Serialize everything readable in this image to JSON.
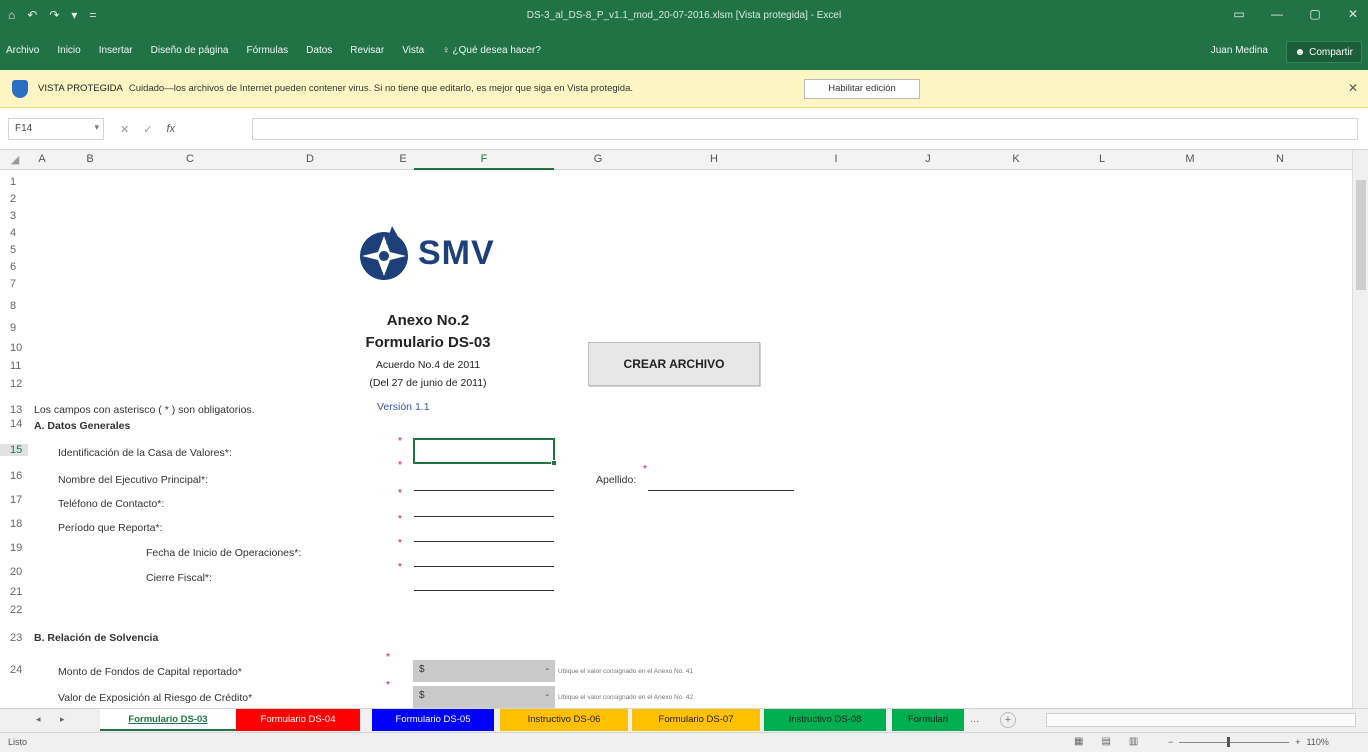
{
  "window": {
    "title": "DS-3_al_DS-8_P_v1.1_mod_20-07-2016.xlsm  [Vista protegida] - Excel",
    "qat": [
      "⌂",
      "↶",
      "↷",
      "▾",
      "="
    ],
    "controls": [
      "▭",
      "—",
      "▢",
      "✕"
    ]
  },
  "ribbon": {
    "tabs": [
      "Archivo",
      "Inicio",
      "Insertar",
      "Diseño de página",
      "Fórmulas",
      "Datos",
      "Revisar",
      "Vista",
      "♀ ¿Qué desea hacer?"
    ],
    "user": "Juan Medina",
    "share": "Compartir"
  },
  "protected_view": {
    "label": "VISTA PROTEGIDA",
    "message": "Cuidado—los archivos de Internet pueden contener virus. Si no tiene que editarlo, es mejor que siga en Vista protegida.",
    "enable_button": "Habilitar edición",
    "close": "✕"
  },
  "formula_bar": {
    "name_box": "F14",
    "cancel": "✕",
    "enter": "✓",
    "fx": "fx",
    "value": ""
  },
  "columns": [
    "A",
    "B",
    "C",
    "D",
    "E",
    "F",
    "G",
    "H",
    "I",
    "J",
    "K",
    "L",
    "M",
    "N"
  ],
  "rows": [
    "1",
    "2",
    "3",
    "4",
    "5",
    "6",
    "7",
    "8",
    "9",
    "10",
    "11",
    "12",
    "13",
    "14",
    "15",
    "16",
    "17",
    "18",
    "19",
    "20",
    "21",
    "22",
    "23",
    "24"
  ],
  "sheet": {
    "logo_text": "SMV",
    "anexo": "Anexo No.2",
    "formulario": "Formulario DS-03",
    "acuerdo": "Acuerdo No.4 de 2011",
    "fecha": "(Del 27 de junio de 2011)",
    "version": "Versión 1.1",
    "required_note": "Los campos con asterisco ( * ) son obligatorios.",
    "crear_button": "CREAR ARCHIVO",
    "section_a": "A. Datos Generales",
    "field_casa": "Identificación de la Casa de Valores*:",
    "field_ejecutivo": "Nombre del Ejecutivo Principal*:",
    "field_apellido": "Apellido:",
    "field_telefono": "Teléfono de Contacto*:",
    "field_periodo": "Período que Reporta*:",
    "field_inicio": "Fecha de Inicio de Operaciones*:",
    "field_cierre": "Cierre Fiscal*:",
    "section_b": "B. Relación de Solvencia",
    "field_monto": "Monto de Fondos de Capital reportado*",
    "field_exposicion": "Valor de Exposición al Riesgo de Crédito*",
    "currency": "$",
    "dash": "-",
    "hint_1": "Ubique el valor consignado en el Anexo No. 41",
    "hint_2": "Ubique el valor consignado en el Anexo No. 42",
    "asterisk": "*"
  },
  "sheet_tabs": [
    {
      "label": "Formulario DS-03",
      "color": "#ffffff"
    },
    {
      "label": "Formulario DS-04",
      "color": "#ff0000"
    },
    {
      "label": "Formulario DS-05",
      "color": "#0000ff"
    },
    {
      "label": "Instructivo DS-06",
      "color": "#ffc000"
    },
    {
      "label": "Formulario DS-07",
      "color": "#ffc000"
    },
    {
      "label": "Instructivo DS-08",
      "color": "#00b050"
    },
    {
      "label": "Formulari",
      "color": "#00b050"
    }
  ],
  "sheet_nav": {
    "prev": "◂",
    "next": "▸",
    "more": "...",
    "add": "+"
  },
  "status": {
    "ready": "Listo",
    "zoom": "110%",
    "zoom_minus": "−",
    "zoom_plus": "+",
    "zoom_fraction": 0.45
  }
}
